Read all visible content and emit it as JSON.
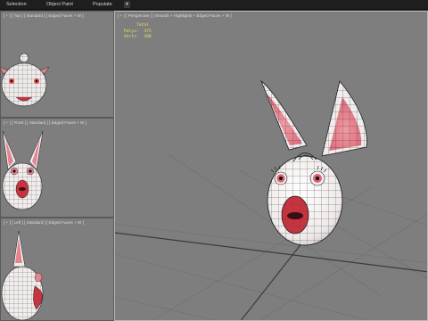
{
  "ribbon": {
    "tabs": [
      "Selection",
      "Object Paint",
      "Populate"
    ],
    "dropdown_label": "▾"
  },
  "viewports": {
    "top": {
      "label": "[ + ] [ Top ] [ Standard ] [ Edged Faces + W ]"
    },
    "front": {
      "label": "[ + ] [ Front ] [ Standard ] [ Edged Faces + W ]"
    },
    "left": {
      "label": "[ + ] [ Left ] [ Standard ] [ Edged Faces + W ]"
    },
    "perspective": {
      "label": "[ + ] [ Perspective ] [ Smooth + Highlights + Edged Faces + W ]",
      "stats": {
        "header": "Total",
        "polys_label": "Polys:",
        "polys_value": "375",
        "verts_label": "Verts:",
        "verts_value": "208"
      }
    }
  },
  "colors": {
    "viewport_bg": "#7e7e7e",
    "grid": "#6f6f6f",
    "mesh_white": "#f1eded",
    "mesh_pink": "#e4848f",
    "mesh_lips": "#c7333f",
    "stats_text": "#f0e060"
  }
}
